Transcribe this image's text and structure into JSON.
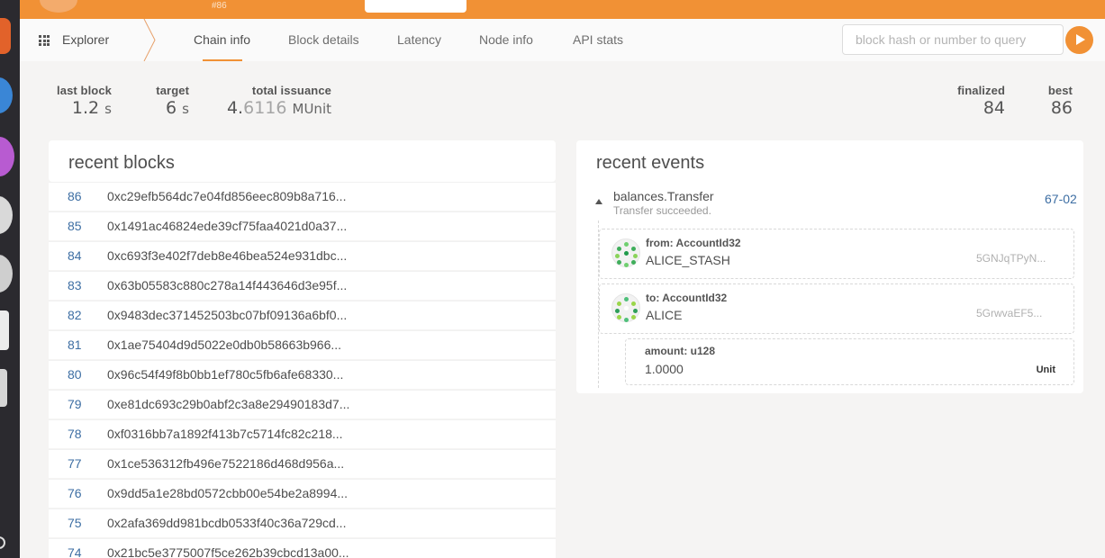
{
  "header": {
    "block_number": "#86"
  },
  "nav": {
    "explorer_label": "Explorer",
    "tabs": [
      {
        "label": "Chain info",
        "active": true
      },
      {
        "label": "Block details",
        "active": false
      },
      {
        "label": "Latency",
        "active": false
      },
      {
        "label": "Node info",
        "active": false
      },
      {
        "label": "API stats",
        "active": false
      }
    ],
    "search_placeholder": "block hash or number to query"
  },
  "summary": {
    "last_block": {
      "label": "last block",
      "value": "1.2",
      "unit": "s"
    },
    "target": {
      "label": "target",
      "value": "6",
      "unit": "s"
    },
    "total_issuance": {
      "label": "total issuance",
      "value_main": "4.",
      "value_dim": "6116",
      "unit": "MUnit"
    },
    "finalized": {
      "label": "finalized",
      "value": "84"
    },
    "best": {
      "label": "best",
      "value": "86"
    }
  },
  "recent_blocks": {
    "title": "recent blocks",
    "rows": [
      {
        "number": "86",
        "hash": "0xc29efb564dc7e04fd856eec809b8a716..."
      },
      {
        "number": "85",
        "hash": "0x1491ac46824ede39cf75faa4021d0a37..."
      },
      {
        "number": "84",
        "hash": "0xc693f3e402f7deb8e46bea524e931dbc..."
      },
      {
        "number": "83",
        "hash": "0x63b05583c880c278a14f443646d3e95f..."
      },
      {
        "number": "82",
        "hash": "0x9483dec371452503bc07bf09136a6bf0..."
      },
      {
        "number": "81",
        "hash": "0x1ae75404d9d5022e0db0b58663b966..."
      },
      {
        "number": "80",
        "hash": "0x96c54f49f8b0bb1ef780c5fb6afe68330..."
      },
      {
        "number": "79",
        "hash": "0xe81dc693c29b0abf2c3a8e29490183d7..."
      },
      {
        "number": "78",
        "hash": "0xf0316bb7a1892f413b7c5714fc82c218..."
      },
      {
        "number": "77",
        "hash": "0x1ce536312fb496e7522186d468d956a..."
      },
      {
        "number": "76",
        "hash": "0x9dd5a1e28bd0572cbb00e54be2a8994..."
      },
      {
        "number": "75",
        "hash": "0x2afa369dd981bcdb0533f40c36a729cd..."
      },
      {
        "number": "74",
        "hash": "0x21bc5e3775007f5ce262b39cbcd13a00..."
      }
    ]
  },
  "recent_events": {
    "title": "recent events",
    "event": {
      "name": "balances.Transfer",
      "description": "Transfer succeeded.",
      "id": "67-02",
      "params": {
        "from": {
          "label": "from: AccountId32",
          "name": "ALICE_STASH",
          "address": "5GNJqTPyN..."
        },
        "to": {
          "label": "to: AccountId32",
          "name": "ALICE",
          "address": "5GrwvaEF5..."
        },
        "amount": {
          "label": "amount: u128",
          "value": "1.0000",
          "unit": "Unit"
        }
      }
    }
  }
}
